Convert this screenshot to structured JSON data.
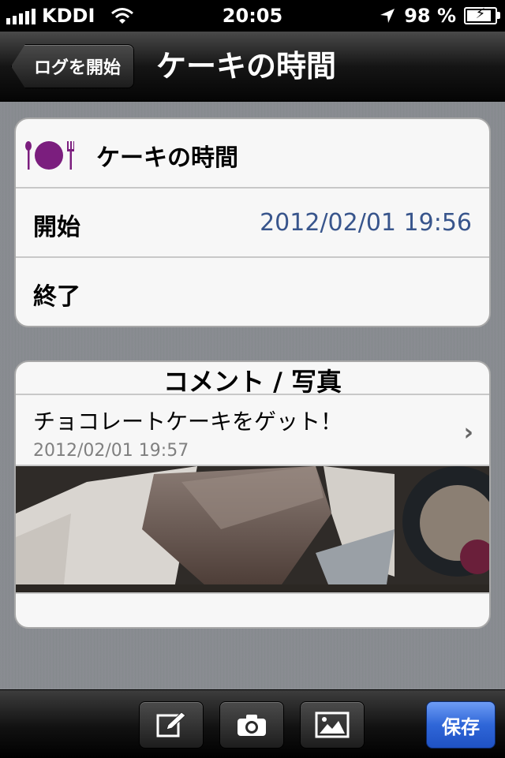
{
  "status_bar": {
    "carrier": "KDDI",
    "time": "20:05",
    "battery": "98 %",
    "battery_level": 0.98
  },
  "nav": {
    "back_label": "ログを開始",
    "title": "ケーキの時間"
  },
  "event": {
    "title": "ケーキの時間",
    "icon": "dining-icon",
    "icon_color": "#7b1e7e",
    "start_label": "開始",
    "start_value": "2012/02/01 19:56",
    "end_label": "終了",
    "end_value": ""
  },
  "comments": {
    "header": "コメント / 写真",
    "items": [
      {
        "text": "チョコレートケーキをゲット！",
        "date": "2012/02/01 19:57"
      }
    ]
  },
  "toolbar": {
    "buttons": [
      "compose-icon",
      "camera-icon",
      "photo-library-icon"
    ],
    "save_label": "保存"
  },
  "colors": {
    "value_blue": "#38558c",
    "save_blue": "#2f66d8"
  }
}
